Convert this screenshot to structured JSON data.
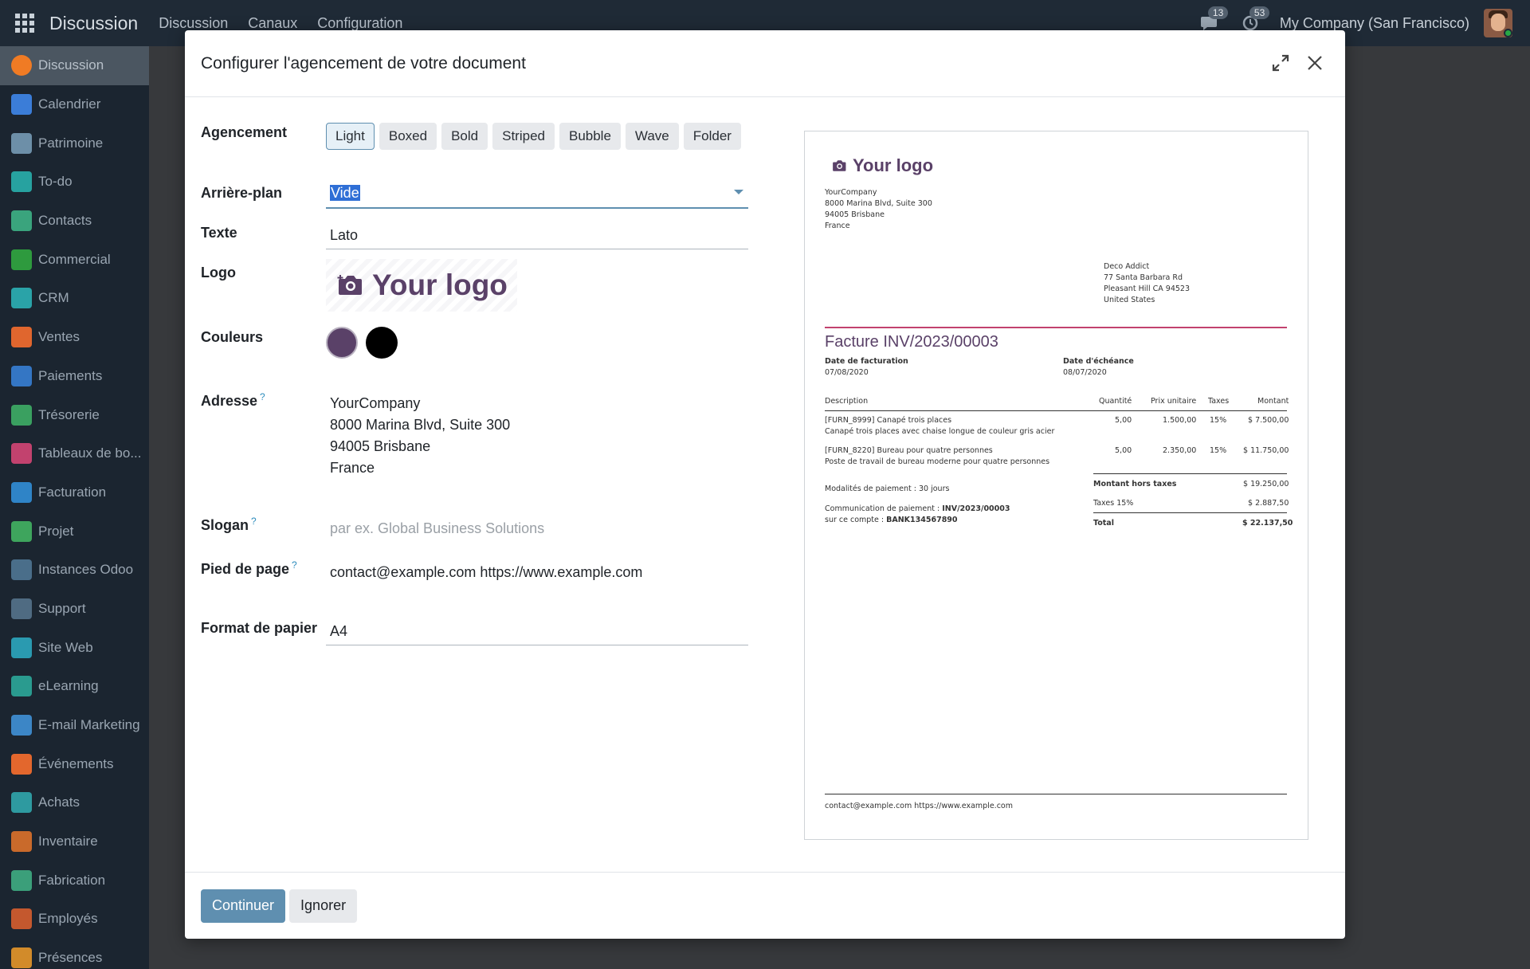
{
  "navbar": {
    "brand": "Discussion",
    "menu": [
      "Discussion",
      "Canaux",
      "Configuration"
    ],
    "messages_count": "13",
    "activities_count": "53",
    "company": "My Company (San Francisco)"
  },
  "sidebar": {
    "items": [
      {
        "label": "Discussion",
        "icon": "discussion-icon",
        "color": "#f07b24"
      },
      {
        "label": "Calendrier",
        "icon": "calendar-icon",
        "color": "#3b7dd8"
      },
      {
        "label": "Patrimoine",
        "icon": "assets-icon",
        "color": "#6d8fa8"
      },
      {
        "label": "To-do",
        "icon": "todo-icon",
        "color": "#27a2a0"
      },
      {
        "label": "Contacts",
        "icon": "contacts-icon",
        "color": "#3aa47d"
      },
      {
        "label": "Commercial",
        "icon": "commercial-icon",
        "color": "#2e9a3e"
      },
      {
        "label": "CRM",
        "icon": "crm-icon",
        "color": "#2aa3a8"
      },
      {
        "label": "Ventes",
        "icon": "sales-icon",
        "color": "#e0662e"
      },
      {
        "label": "Paiements",
        "icon": "payments-icon",
        "color": "#3476c4"
      },
      {
        "label": "Trésorerie",
        "icon": "treasury-icon",
        "color": "#3aa060"
      },
      {
        "label": "Tableaux de bo...",
        "icon": "dashboards-icon",
        "color": "#c2426e"
      },
      {
        "label": "Facturation",
        "icon": "invoicing-icon",
        "color": "#2f84c7"
      },
      {
        "label": "Projet",
        "icon": "project-icon",
        "color": "#3ea55d"
      },
      {
        "label": "Instances Odoo",
        "icon": "instances-icon",
        "color": "#4a6e8a"
      },
      {
        "label": "Support",
        "icon": "support-icon",
        "color": "#4f6b82"
      },
      {
        "label": "Site Web",
        "icon": "website-icon",
        "color": "#2a9ab0"
      },
      {
        "label": "eLearning",
        "icon": "elearning-icon",
        "color": "#2a9b8f"
      },
      {
        "label": "E-mail Marketing",
        "icon": "email-marketing-icon",
        "color": "#3c86c6"
      },
      {
        "label": "Événements",
        "icon": "events-icon",
        "color": "#e3672d"
      },
      {
        "label": "Achats",
        "icon": "purchase-icon",
        "color": "#2e9aa0"
      },
      {
        "label": "Inventaire",
        "icon": "inventory-icon",
        "color": "#c96a2b"
      },
      {
        "label": "Fabrication",
        "icon": "manufacturing-icon",
        "color": "#3b9f7a"
      },
      {
        "label": "Employés",
        "icon": "employees-icon",
        "color": "#c4582e"
      },
      {
        "label": "Présences",
        "icon": "attendances-icon",
        "color": "#d28b2a"
      }
    ]
  },
  "modal": {
    "title": "Configurer l'agencement de votre document",
    "labels": {
      "layout": "Agencement",
      "background": "Arrière-plan",
      "font": "Texte",
      "logo": "Logo",
      "colors": "Couleurs",
      "address": "Adresse",
      "tagline": "Slogan",
      "footer": "Pied de page",
      "paper": "Format de papier",
      "help": "?"
    },
    "layouts": [
      "Light",
      "Boxed",
      "Bold",
      "Striped",
      "Bubble",
      "Wave",
      "Folder"
    ],
    "selected_layout": "Light",
    "background_value": "Vide",
    "font_value": "Lato",
    "logo_text": "Your logo",
    "colors": {
      "primary": "#5a4168",
      "secondary": "#000000"
    },
    "address_lines": [
      "YourCompany",
      "8000 Marina Blvd, Suite 300",
      "94005 Brisbane",
      "France"
    ],
    "tagline_placeholder": "par ex. Global Business Solutions",
    "footer_value": "contact@example.com https://www.example.com",
    "paper_value": "A4",
    "buttons": {
      "continue": "Continuer",
      "ignore": "Ignorer"
    }
  },
  "preview": {
    "logo_text": "Your logo",
    "company_lines": [
      "YourCompany",
      "8000 Marina Blvd, Suite 300",
      "94005 Brisbane",
      "France"
    ],
    "customer_lines": [
      "Deco Addict",
      "77 Santa Barbara Rd",
      "Pleasant Hill CA 94523",
      "United States"
    ],
    "invoice_title": "Facture INV/2023/00003",
    "invoice_date_label": "Date de facturation",
    "invoice_date": "07/08/2020",
    "due_date_label": "Date d'échéance",
    "due_date": "08/07/2020",
    "table_headers": [
      "Description",
      "Quantité",
      "Prix unitaire",
      "Taxes",
      "Montant"
    ],
    "rows": [
      {
        "desc1": "[FURN_8999] Canapé trois places",
        "desc2": "Canapé trois places avec chaise longue de couleur gris acier",
        "qty": "5,00",
        "price": "1.500,00",
        "tax": "15%",
        "amount": "$ 7.500,00"
      },
      {
        "desc1": "[FURN_8220] Bureau pour quatre personnes",
        "desc2": "Poste de travail de bureau moderne pour quatre personnes",
        "qty": "5,00",
        "price": "2.350,00",
        "tax": "15%",
        "amount": "$ 11.750,00"
      }
    ],
    "payment_terms": "Modalités de paiement : 30 jours",
    "payment_comm_label": "Communication de paiement :",
    "payment_comm_value": "INV/2023/00003",
    "account_label": "sur ce compte :",
    "account_value": "BANK134567890",
    "untaxed_label": "Montant hors taxes",
    "untaxed_value": "$ 19.250,00",
    "tax_label": "Taxes 15%",
    "tax_value": "$ 2.887,50",
    "total_label": "Total",
    "total_value": "$ 22.137,50",
    "footer": "contact@example.com https://www.example.com"
  }
}
